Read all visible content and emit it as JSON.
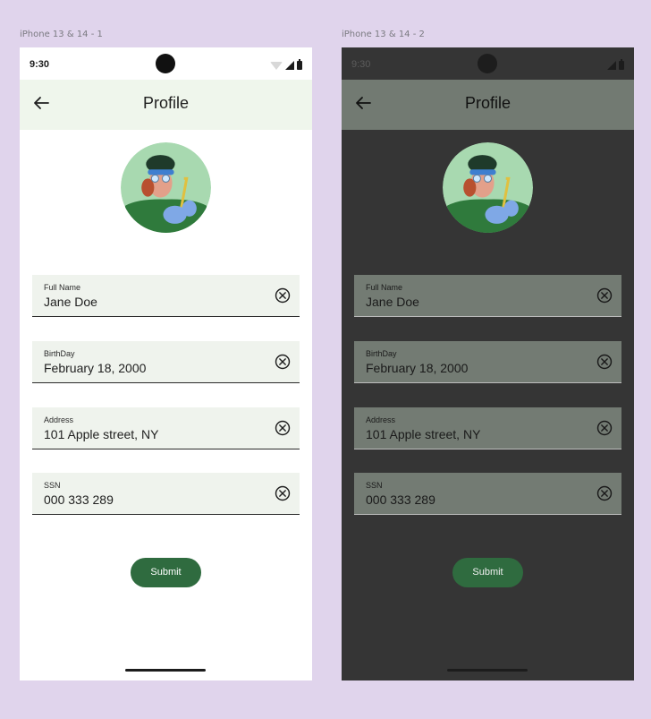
{
  "frames": [
    {
      "label": "iPhone 13 & 14 - 1",
      "theme": "light",
      "status": {
        "time": "9:30"
      },
      "appbar": {
        "title": "Profile"
      },
      "fields": [
        {
          "label": "Full Name",
          "value": "Jane Doe"
        },
        {
          "label": "BirthDay",
          "value": "February 18, 2000"
        },
        {
          "label": "Address",
          "value": "101 Apple street, NY"
        },
        {
          "label": "SSN",
          "value": "000 333 289"
        }
      ],
      "submit_label": "Submit"
    },
    {
      "label": "iPhone 13 & 14 - 2",
      "theme": "dark",
      "status": {
        "time": "9:30"
      },
      "appbar": {
        "title": "Profile"
      },
      "fields": [
        {
          "label": "Full Name",
          "value": "Jane Doe"
        },
        {
          "label": "BirthDay",
          "value": "February 18, 2000"
        },
        {
          "label": "Address",
          "value": "101 Apple street, NY"
        },
        {
          "label": "SSN",
          "value": "000 333 289"
        }
      ],
      "submit_label": "Submit"
    }
  ],
  "colors": {
    "canvas": "#e0d4ec",
    "accent": "#2f6b3f",
    "light_appbar": "#eff6ec",
    "dark_surface": "#353535",
    "dark_appbar": "#727a72"
  },
  "icons": {
    "back": "arrow-back-icon",
    "clear": "clear-circle-icon",
    "avatar": "profile-avatar-illustration"
  }
}
